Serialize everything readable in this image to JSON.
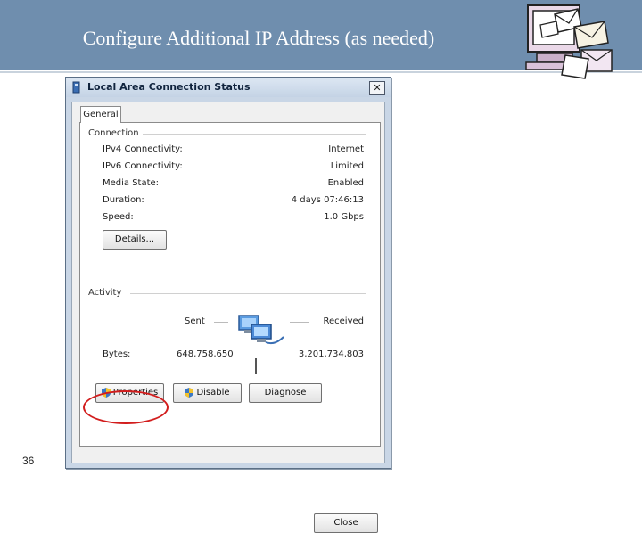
{
  "slide": {
    "title": "Configure Additional IP Address (as needed)",
    "page_number": "36"
  },
  "dialog": {
    "title": "Local Area Connection Status",
    "close_glyph": "✕",
    "tab": "General",
    "connection": {
      "label": "Connection",
      "rows": [
        {
          "label": "IPv4 Connectivity:",
          "value": "Internet"
        },
        {
          "label": "IPv6 Connectivity:",
          "value": "Limited"
        },
        {
          "label": "Media State:",
          "value": "Enabled"
        },
        {
          "label": "Duration:",
          "value": "4 days 07:46:13"
        },
        {
          "label": "Speed:",
          "value": "1.0 Gbps"
        }
      ],
      "details_button": "Details..."
    },
    "activity": {
      "label": "Activity",
      "sent_label": "Sent",
      "received_label": "Received",
      "bytes_label": "Bytes:",
      "bytes_sent": "648,758,650",
      "bytes_received": "3,201,734,803"
    },
    "buttons": {
      "properties": "Properties",
      "disable": "Disable",
      "diagnose": "Diagnose",
      "close": "Close"
    },
    "highlight_color": "#d21d1d"
  },
  "icons": {
    "window_icon": "network-adapter-icon",
    "shield": "uac-shield-icon",
    "network": "network-computers-icon",
    "clipart": "computer-mail-clipart"
  }
}
